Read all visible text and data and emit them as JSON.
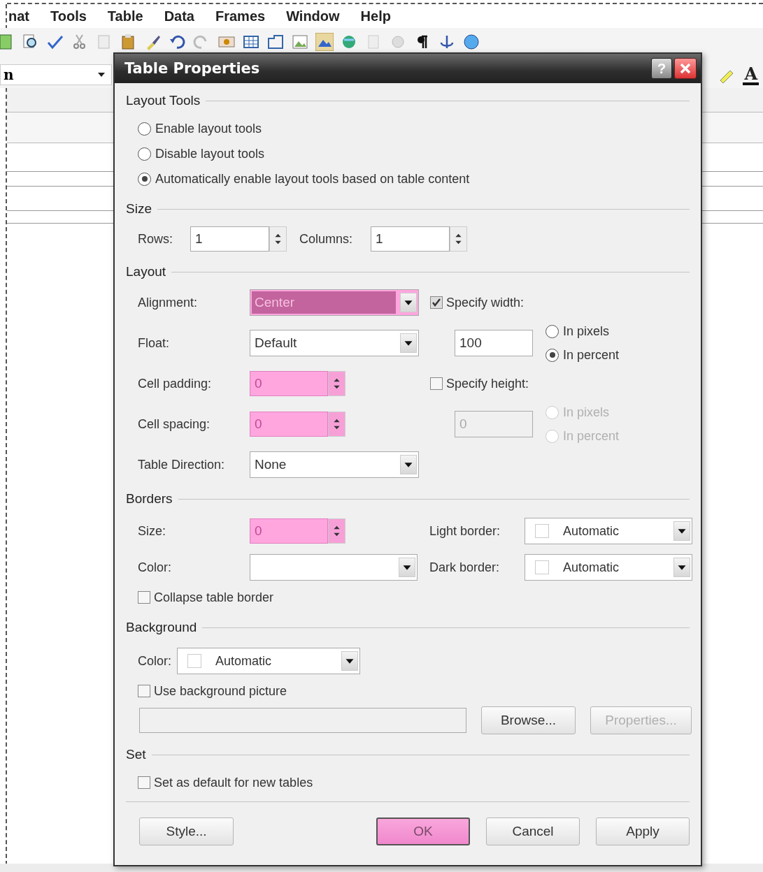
{
  "app": {
    "menu": [
      {
        "label": "nat"
      },
      {
        "label": "Tools"
      },
      {
        "label": "Table"
      },
      {
        "label": "Data"
      },
      {
        "label": "Frames"
      },
      {
        "label": "Window"
      },
      {
        "label": "Help"
      }
    ],
    "style_field": {
      "value": "n"
    },
    "font_color_button": {
      "label": "A"
    }
  },
  "dialog": {
    "title": "Table Properties",
    "help_button": "?",
    "layout_tools": {
      "title": "Layout Tools",
      "options": [
        {
          "label": "Enable layout tools",
          "selected": false
        },
        {
          "label": "Disable layout tools",
          "selected": false
        },
        {
          "label": "Automatically enable layout tools based on table content",
          "selected": true
        }
      ]
    },
    "size": {
      "title": "Size",
      "fields": [
        {
          "label": "Rows:",
          "value": "1"
        },
        {
          "label": "Columns:",
          "value": "1"
        }
      ]
    },
    "layout": {
      "title": "Layout",
      "fields": [
        {
          "kind": "dropdown",
          "label": "Alignment:",
          "value": "Center",
          "highlighted": true
        },
        {
          "kind": "dropdown",
          "label": "Float:",
          "value": "Default",
          "highlighted": false
        },
        {
          "kind": "spin",
          "label": "Cell padding:",
          "value": "0",
          "highlighted": true
        },
        {
          "kind": "spin",
          "label": "Cell spacing:",
          "value": "0",
          "highlighted": true
        },
        {
          "kind": "dropdown",
          "label": "Table Direction:",
          "value": "None",
          "highlighted": false
        }
      ],
      "width": {
        "label": "Specify width:",
        "checked": true,
        "value": "100",
        "disabled": false,
        "units": [
          {
            "label": "In pixels",
            "selected": false
          },
          {
            "label": "In percent",
            "selected": true
          }
        ]
      },
      "height": {
        "label": "Specify height:",
        "checked": false,
        "value": "0",
        "disabled": true,
        "units": [
          {
            "label": "In pixels",
            "selected": false
          },
          {
            "label": "In percent",
            "selected": false
          }
        ]
      }
    },
    "borders": {
      "title": "Borders",
      "size": {
        "label": "Size:",
        "value": "0",
        "highlighted": true
      },
      "color": {
        "label": "Color:"
      },
      "light_border": {
        "label": "Light border:",
        "value": "Automatic"
      },
      "dark_border": {
        "label": "Dark border:",
        "value": "Automatic"
      },
      "collapse": {
        "label": "Collapse table border",
        "checked": false
      }
    },
    "background": {
      "title": "Background",
      "color": {
        "label": "Color:",
        "value": "Automatic"
      },
      "use_picture": {
        "label": "Use background picture",
        "checked": false
      },
      "picture_path": {
        "disabled": true
      },
      "browse_button": {
        "label": "Browse...",
        "disabled": false
      },
      "properties_button": {
        "label": "Properties...",
        "disabled": true
      }
    },
    "set": {
      "title": "Set",
      "default": {
        "label": "Set as default for new tables",
        "checked": false
      }
    },
    "style_button": {
      "label": "Style...",
      "highlighted": false
    },
    "buttons": [
      {
        "label": "OK",
        "highlighted": true
      },
      {
        "label": "Cancel",
        "highlighted": false
      },
      {
        "label": "Apply",
        "highlighted": false
      }
    ]
  }
}
